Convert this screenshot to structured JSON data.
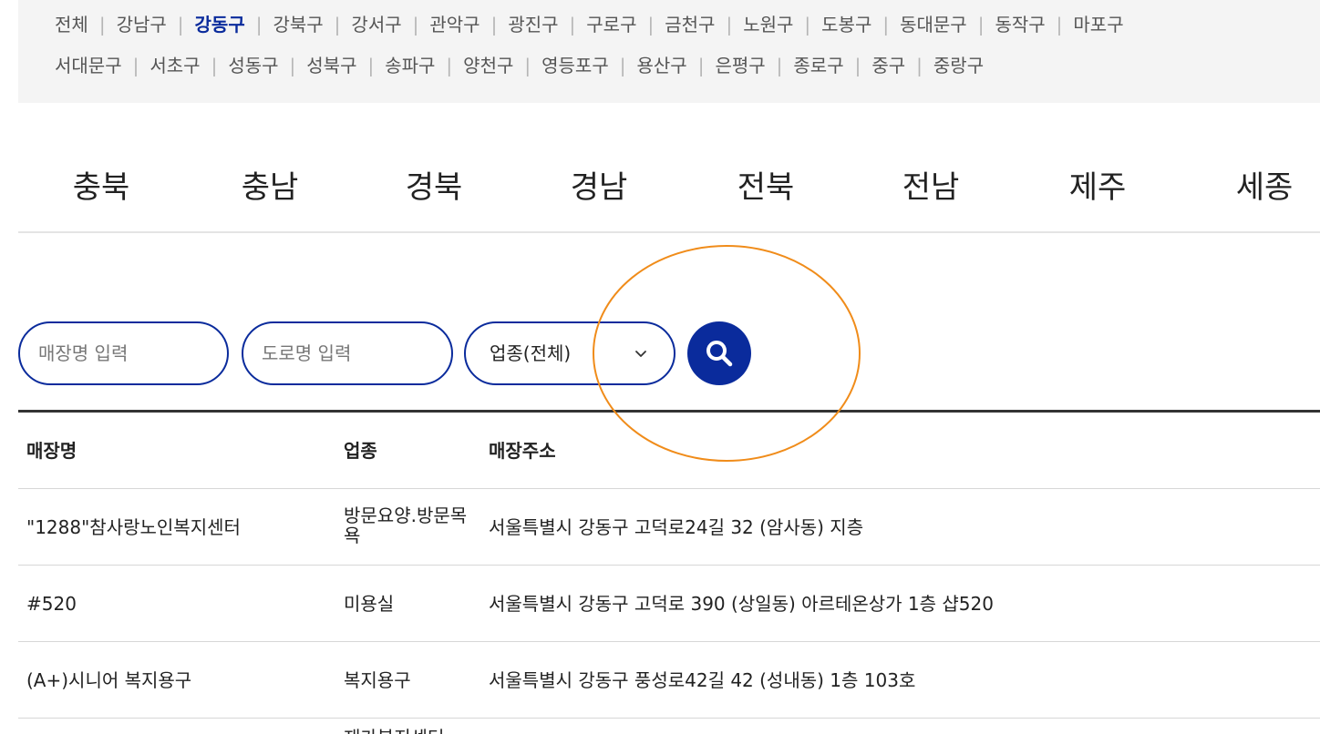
{
  "districts": {
    "row1": [
      "전체",
      "강남구",
      "강동구",
      "강북구",
      "강서구",
      "관악구",
      "광진구",
      "구로구",
      "금천구",
      "노원구",
      "도봉구",
      "동대문구",
      "동작구",
      "마포구"
    ],
    "row2": [
      "서대문구",
      "서초구",
      "성동구",
      "성북구",
      "송파구",
      "양천구",
      "영등포구",
      "용산구",
      "은평구",
      "종로구",
      "중구",
      "중랑구"
    ],
    "active": "강동구"
  },
  "provinces": [
    "충북",
    "충남",
    "경북",
    "경남",
    "전북",
    "전남",
    "제주",
    "세종"
  ],
  "search": {
    "store_placeholder": "매장명 입력",
    "road_placeholder": "도로명 입력",
    "category_selected": "업종(전체)",
    "search_icon": "search-icon",
    "chevron_icon": "chevron-down-icon"
  },
  "table": {
    "headers": {
      "name": "매장명",
      "type": "업종",
      "address": "매장주소"
    },
    "rows": [
      {
        "name": "\"1288\"참사랑노인복지센터",
        "type": "방문요양.방문목욕",
        "address": "서울특별시 강동구 고덕로24길 32 (암사동) 지층"
      },
      {
        "name": "#520",
        "type": "미용실",
        "address": "서울특별시 강동구 고덕로 390 (상일동) 아르테온상가 1층 샵520"
      },
      {
        "name": "(A+)시니어 복지용구",
        "type": "복지용구",
        "address": "서울특별시 강동구 풍성로42길 42 (성내동) 1층 103호"
      },
      {
        "name": "",
        "type": "재가복지센터",
        "address": ""
      }
    ]
  },
  "colors": {
    "accent": "#0a2b9c",
    "annotation": "#f08c1a",
    "panel_bg": "#f4f4f4"
  }
}
